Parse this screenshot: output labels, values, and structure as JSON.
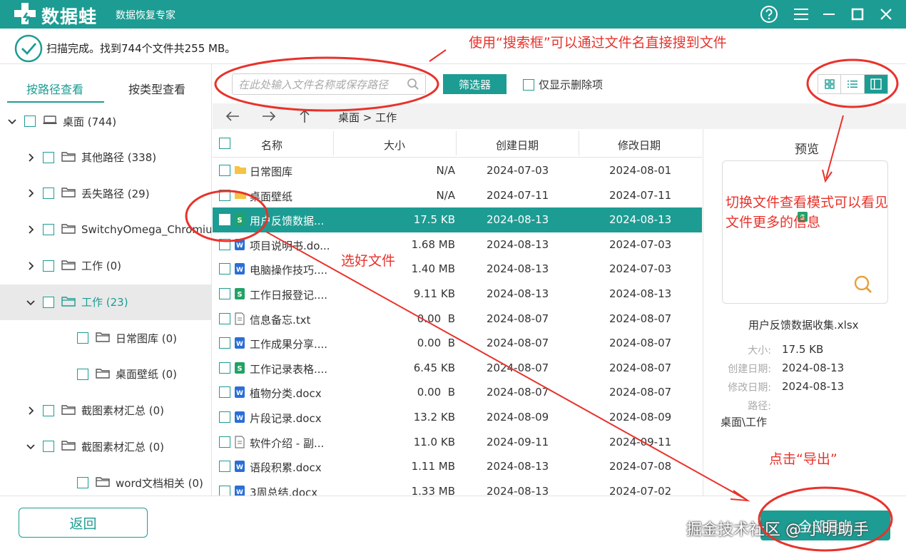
{
  "app": {
    "name": "数据蛙",
    "subtitle": "数据恢复专家",
    "accent_color": "#1d9c93",
    "annotation_color": "#e8322b"
  },
  "status": {
    "message": "扫描完成。找到744个文件共255 MB。"
  },
  "left_tabs": [
    {
      "label": "按路径查看",
      "active": true
    },
    {
      "label": "按类型查看",
      "active": false
    }
  ],
  "tree": [
    {
      "label": "桌面 (744)",
      "expanded": true,
      "icon": "computer-icon"
    },
    {
      "label": "其他路径 (338)",
      "expanded": false,
      "icon": "folder-icon"
    },
    {
      "label": "丢失路径 (29)",
      "expanded": false,
      "icon": "folder-icon"
    },
    {
      "label": "SwitchyOmega_Chromium",
      "expanded": false,
      "icon": "folder-icon"
    },
    {
      "label": "工作 (0)",
      "expanded": false,
      "icon": "folder-icon"
    },
    {
      "label": "工作 (23)",
      "expanded": true,
      "selected": true,
      "icon": "folder-icon"
    },
    {
      "label": "日常图库 (0)",
      "icon": "folder-icon"
    },
    {
      "label": "桌面壁纸 (0)",
      "icon": "folder-icon"
    },
    {
      "label": "截图素材汇总 (0)",
      "expanded": false,
      "icon": "folder-icon"
    },
    {
      "label": "截图素材汇总 (0)",
      "expanded": true,
      "icon": "folder-icon"
    },
    {
      "label": "word文档相关 (0)",
      "icon": "folder-icon"
    }
  ],
  "toolbar": {
    "search_placeholder": "在此处输入文件名称或保存路径",
    "filter_label": "筛选器",
    "only_deleted_label": "仅显示删除项"
  },
  "nav": {
    "breadcrumb": "桌面 > 工作"
  },
  "table": {
    "columns": [
      "名称",
      "大小",
      "创建日期",
      "修改日期"
    ],
    "rows": [
      {
        "name": "日常图库",
        "size": "N/A",
        "created": "2024-07-03",
        "modified": "2024-08-01",
        "icon": "folder-icon"
      },
      {
        "name": "桌面壁纸",
        "size": "N/A",
        "created": "2024-07-11",
        "modified": "2024-07-11",
        "icon": "folder-icon"
      },
      {
        "name": "用户反馈数据...",
        "size": "17.5 KB",
        "created": "2024-08-13",
        "modified": "2024-08-13",
        "icon": "excel-file-icon",
        "selected": true
      },
      {
        "name": "项目说明书.do...",
        "size": "1.68 MB",
        "created": "2024-08-13",
        "modified": "2024-07-03",
        "icon": "word-file-icon"
      },
      {
        "name": "电脑操作技巧....",
        "size": "1.40 MB",
        "created": "2024-08-13",
        "modified": "2024-07-03",
        "icon": "word-file-icon"
      },
      {
        "name": "工作日报登记....",
        "size": "9.11 KB",
        "created": "2024-08-13",
        "modified": "2024-08-13",
        "icon": "excel-file-icon"
      },
      {
        "name": "信息备忘.txt",
        "size": "0.00  B",
        "created": "2024-08-07",
        "modified": "2024-08-07",
        "icon": "text-file-icon"
      },
      {
        "name": "工作成果分享....",
        "size": "0.00  B",
        "created": "2024-08-07",
        "modified": "2024-08-07",
        "icon": "word-file-icon"
      },
      {
        "name": "工作记录表格....",
        "size": "6.45 KB",
        "created": "2024-08-07",
        "modified": "2024-08-07",
        "icon": "excel-file-icon"
      },
      {
        "name": "植物分类.docx",
        "size": "0.00  B",
        "created": "2024-08-07",
        "modified": "2024-08-07",
        "icon": "word-file-icon"
      },
      {
        "name": "片段记录.docx",
        "size": "13.2 KB",
        "created": "2024-08-09",
        "modified": "2024-08-09",
        "icon": "word-file-icon"
      },
      {
        "name": "软件介绍 - 副...",
        "size": "11.0 KB",
        "created": "2024-09-11",
        "modified": "2024-09-11",
        "icon": "text-file-icon"
      },
      {
        "name": "语段积累.docx",
        "size": "1.11 MB",
        "created": "2024-08-13",
        "modified": "2024-07-08",
        "icon": "word-file-icon"
      },
      {
        "name": "3周总结.docx",
        "size": "1.33 MB",
        "created": "2024-08-13",
        "modified": "2024-07-02",
        "icon": "word-file-icon"
      }
    ]
  },
  "preview": {
    "title": "预览",
    "file_name": "用户反馈数据收集.xlsx",
    "size_label": "大小:",
    "size_value": "17.5 KB",
    "created_label": "创建日期:",
    "created_value": "2024-08-13",
    "modified_label": "修改日期:",
    "modified_value": "2024-08-13",
    "path_label": "路径:",
    "path_value": "桌面\\工作"
  },
  "bottom": {
    "back_label": "返回",
    "export_label": "全部导出",
    "watermark": "掘金技术社区 @ 小明助手"
  },
  "annotations": {
    "search_tip": "使用“搜索框”可以通过文件名直接搜到文件",
    "view_tip": "切换文件查看模式可以看见文件更多的信息",
    "select_tip": "选好文件",
    "export_tip": "点击“导出”"
  }
}
